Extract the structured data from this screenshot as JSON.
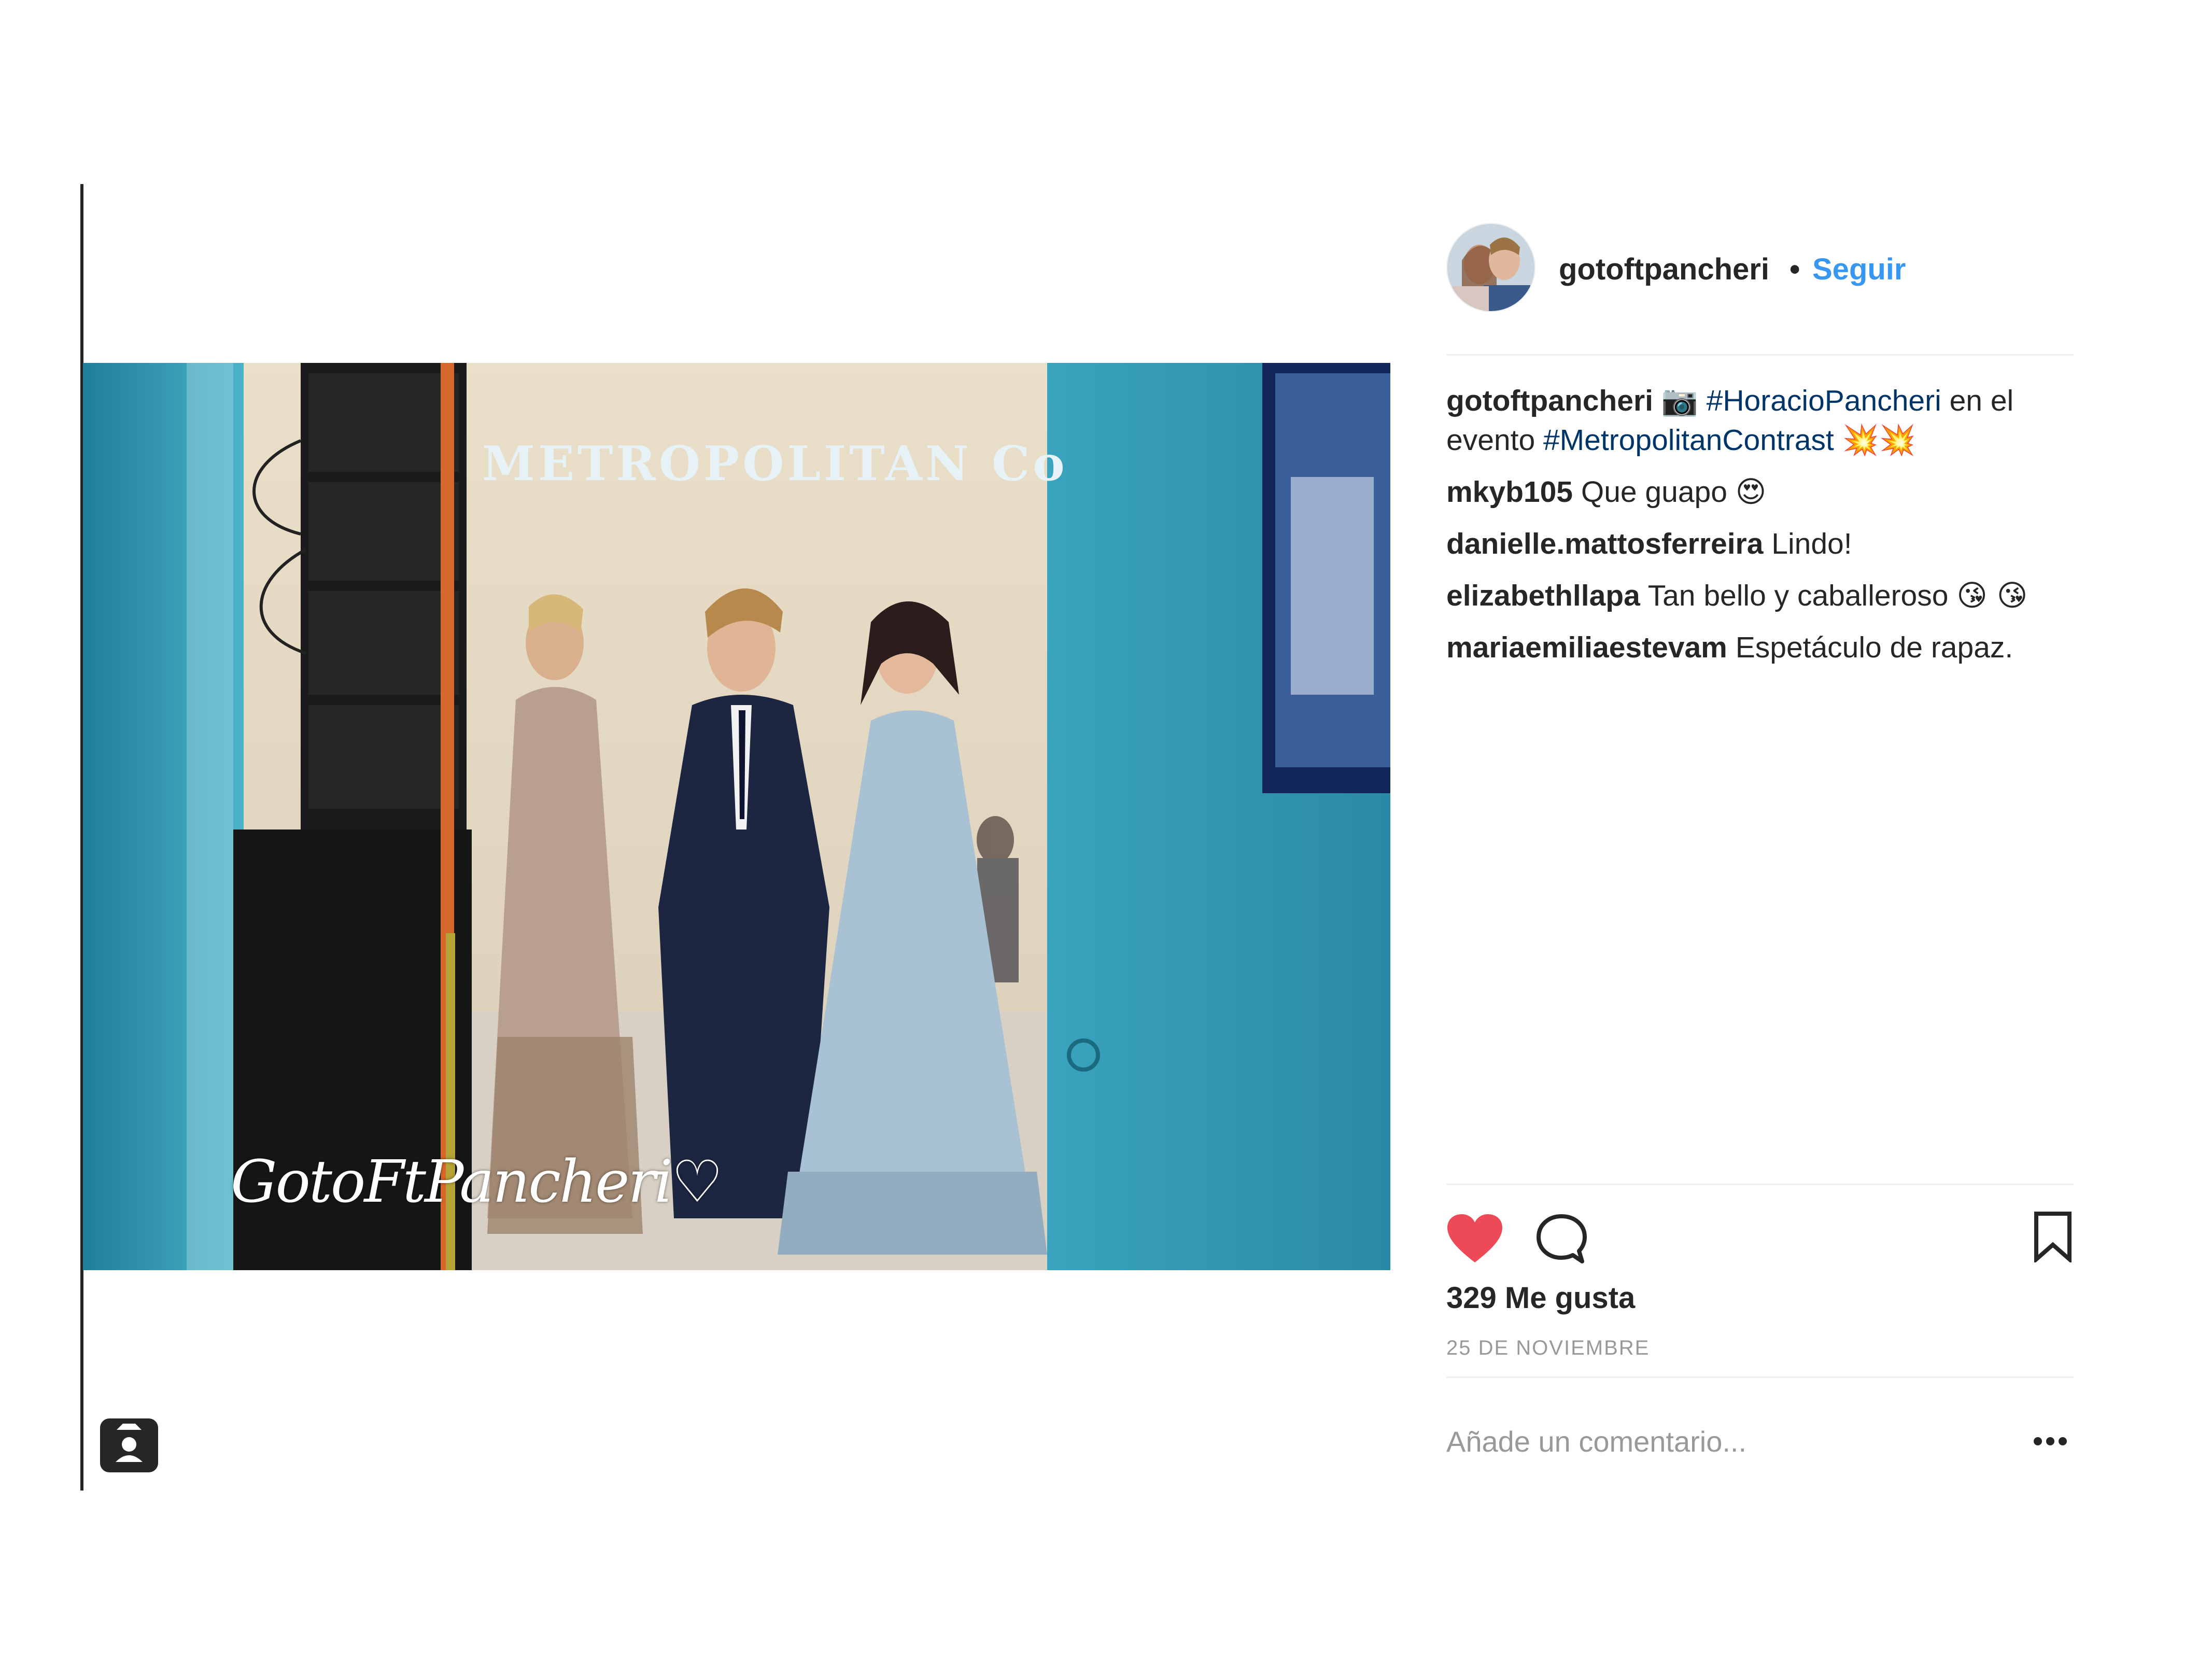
{
  "post": {
    "username": "gotoftpancheri",
    "follow_dot": "•",
    "follow_label": "Seguir",
    "caption": {
      "user": "gotoftpancheri",
      "camera_emoji": "📷",
      "hashtag1": "#HoracioPancheri",
      "text1": "en el evento",
      "hashtag2": "#MetropolitanContrast",
      "emojis": "💥💥"
    },
    "comments": [
      {
        "user": "mkyb105",
        "text": "Que guapo",
        "emoji": "😍"
      },
      {
        "user": "danielle.mattosferreira",
        "text": "Lindo!",
        "emoji": ""
      },
      {
        "user": "elizabethllapa",
        "text": "Tan bello y caballeroso",
        "emoji": "😘 😘"
      },
      {
        "user": "mariaemiliaestevam",
        "text": "Espetáculo de rapaz.",
        "emoji": ""
      }
    ],
    "likes": "329 Me gusta",
    "date": "25 DE NOVIEMBRE",
    "comment_placeholder": "Añade un comentario...",
    "image": {
      "watermark": "GotoFtPancheri♡",
      "sign_text": "METROPOLITAN Co"
    }
  },
  "colors": {
    "like_red": "#ed4956",
    "link_blue": "#3897f0",
    "hashtag_blue": "#003569",
    "muted_gray": "#999999"
  },
  "icons": [
    "heart-icon",
    "comment-icon",
    "bookmark-icon",
    "more-options-icon",
    "tag-user-icon"
  ]
}
